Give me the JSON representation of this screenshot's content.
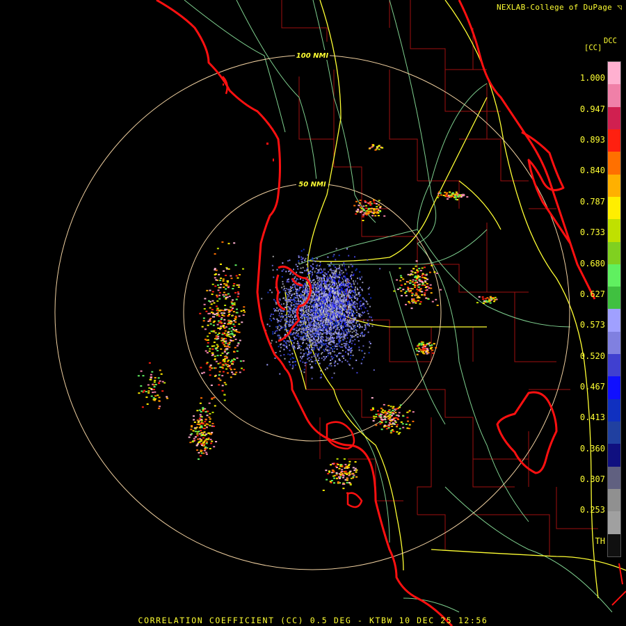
{
  "header": {
    "credit": "NEXLAB-College of DuPage"
  },
  "footer": {
    "product_line": "CORRELATION COEFFICIENT (CC) 0.5 DEG - KTBW 10 DEC 25 12:56"
  },
  "rings": [
    {
      "label": "50 NMI"
    },
    {
      "label": "100 NMI"
    }
  ],
  "legend": {
    "code": "DCC",
    "unit": "[CC]",
    "labels": [
      "1.000",
      "0.947",
      "0.893",
      "0.840",
      "0.787",
      "0.733",
      "0.680",
      "0.627",
      "0.573",
      "0.520",
      "0.467",
      "0.413",
      "0.360",
      "0.307",
      "0.253",
      "TH"
    ],
    "colors": [
      "#ffb0d0",
      "#f080a8",
      "#d02050",
      "#ff2010",
      "#ff7000",
      "#ffb000",
      "#ffee00",
      "#c0e000",
      "#80d020",
      "#60f060",
      "#40c040",
      "#a0a0ff",
      "#8080e0",
      "#4040d0",
      "#1010ff",
      "#1030c0",
      "#2040a0",
      "#101080",
      "#606080",
      "#909090",
      "#a0a0a0",
      "#101010"
    ]
  },
  "colors": {
    "coast": "#ff1010",
    "county": "#a01010",
    "highway": "#ffff33",
    "road": "#7fd08f",
    "ring": "#f0d0a0",
    "text": "#ffff33"
  }
}
